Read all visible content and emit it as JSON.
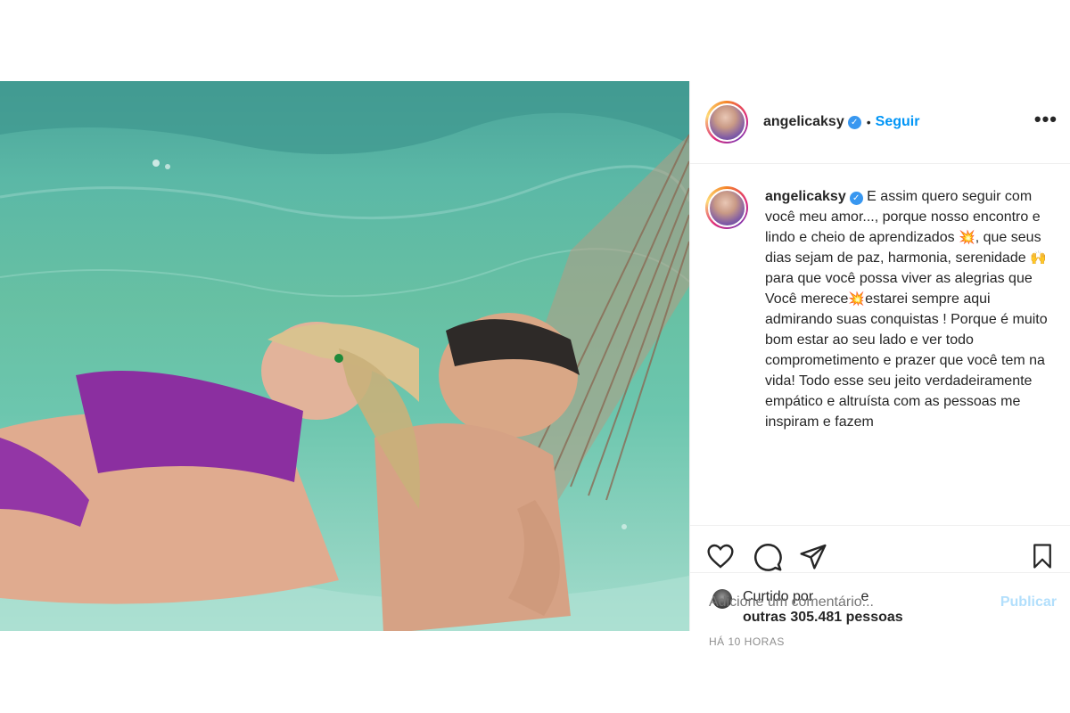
{
  "post": {
    "author": "angelicaksy",
    "verified_badge": "✓",
    "separator": "•",
    "follow_label": "Seguir",
    "more_label": "•••",
    "caption": {
      "username": "angelicaksy",
      "part1": " E assim quero seguir com você meu amor..., porque nosso encontro e lindo e cheio de aprendizados ",
      "emoji1": "💥",
      "part2": ", que seus dias sejam de paz, harmonia, serenidade ",
      "emoji2": "🙌",
      "part3": " para que você possa viver as alegrias que Você merece",
      "emoji3": "💥",
      "part4": "estarei sempre aqui admirando suas conquistas ! Porque é muito bom estar ao seu lado e ver todo comprometimento e prazer que você tem na vida! Todo esse seu jeito verdadeiramente empático e altruísta com as pessoas me inspiram e fazem"
    },
    "likes": {
      "prefix": "Curtido por",
      "redacted_name": "          ",
      "connector": "e",
      "others": "outras 305.481 pessoas"
    },
    "time_ago": "HÁ 10 HORAS",
    "comment": {
      "placeholder": "Adicione um comentário...",
      "publish_label": "Publicar"
    },
    "icons": [
      "heart-icon",
      "comment-icon",
      "share-icon",
      "bookmark-icon",
      "more-icon",
      "verified-icon"
    ],
    "colors": {
      "link_blue": "#0095f6",
      "publish_disabled": "#b2dffc",
      "verified_blue": "#3897f0",
      "meta_gray": "#8e8e8e"
    }
  }
}
